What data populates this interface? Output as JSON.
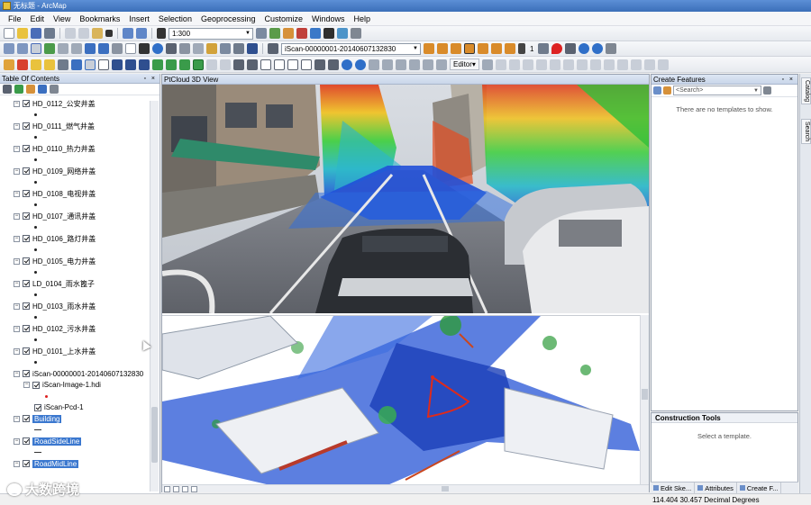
{
  "window": {
    "title": "无标题 - ArcMap"
  },
  "menu": [
    "File",
    "Edit",
    "View",
    "Bookmarks",
    "Insert",
    "Selection",
    "Geoprocessing",
    "Customize",
    "Windows",
    "Help"
  ],
  "toolbar": {
    "scale_value": "1:300",
    "scan_layer": "iScan-00000001-20140607132830",
    "frame_number": "1",
    "editor_label": "Editor▾"
  },
  "toc": {
    "title": "Table Of Contents",
    "layers": [
      {
        "name": "HD_0112_公安井盖"
      },
      {
        "name": "HD_0111_燃气井盖"
      },
      {
        "name": "HD_0110_热力井盖"
      },
      {
        "name": "HD_0109_网络井盖"
      },
      {
        "name": "HD_0108_电视井盖"
      },
      {
        "name": "HD_0107_通讯井盖"
      },
      {
        "name": "HD_0106_路灯井盖"
      },
      {
        "name": "HD_0105_电力井盖"
      },
      {
        "name": "LD_0104_雨水篦子"
      },
      {
        "name": "HD_0103_雨水井盖"
      },
      {
        "name": "HD_0102_污水井盖"
      },
      {
        "name": "HD_0101_上水井盖"
      }
    ],
    "group": {
      "name": "iScan-00000001-20140607132830",
      "image_layer": "iScan-Image-1.hdi",
      "pcd_layer": "iScan-Pcd-1"
    },
    "selected_layers": [
      "Building",
      "RoadSideLine",
      "RoadMidLine"
    ]
  },
  "view3d": {
    "title": "PtCloud 3D View"
  },
  "features": {
    "title": "Create Features",
    "search_placeholder": "<Search>",
    "empty_message": "There are no templates to show."
  },
  "construction": {
    "title": "Construction Tools",
    "message": "Select a template."
  },
  "bottom_tabs": [
    "Edit Ske...",
    "Attributes",
    "Create F..."
  ],
  "side_tabs": [
    "Catalog",
    "Search"
  ],
  "status": {
    "coordinates": "114.404  30.457 Decimal Degrees"
  },
  "watermark": "大数跨境",
  "colors": {
    "accent": "#3b78cf",
    "titlebar": "#3b6fb9",
    "cloud_blue": "#1f4fd6",
    "cloud_green": "#26c23a",
    "cloud_red": "#e02a1a"
  }
}
